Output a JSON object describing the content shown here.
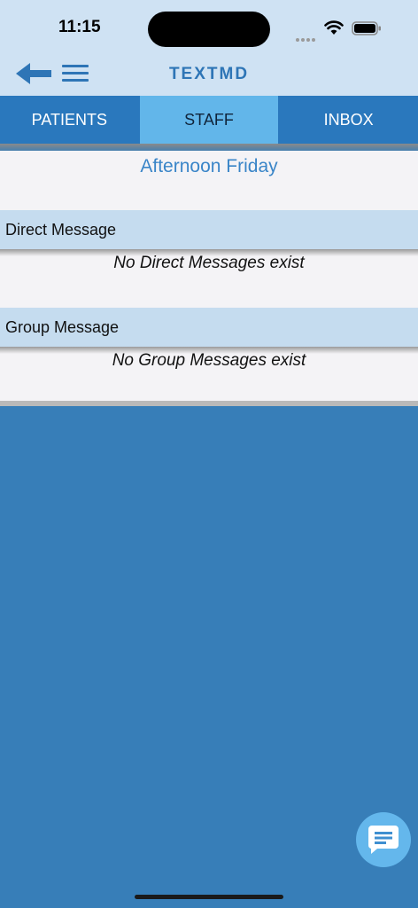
{
  "status_bar": {
    "time": "11:15"
  },
  "nav": {
    "title": "TEXTMD"
  },
  "tabs": [
    {
      "label": "PATIENTS",
      "active": false
    },
    {
      "label": "STAFF",
      "active": true
    },
    {
      "label": "INBOX",
      "active": false
    }
  ],
  "main": {
    "subtitle": "Afternoon Friday",
    "direct": {
      "header": "Direct Message",
      "empty": "No Direct Messages exist"
    },
    "group": {
      "header": "Group Message",
      "empty": "No Group Messages exist"
    }
  },
  "colors": {
    "accent": "#2e75b6",
    "background": "#377eb8",
    "active_tab": "#62b6ea"
  },
  "icons": {
    "back": "arrow-left-icon",
    "menu": "hamburger-icon",
    "chat": "chat-bubble-icon"
  }
}
